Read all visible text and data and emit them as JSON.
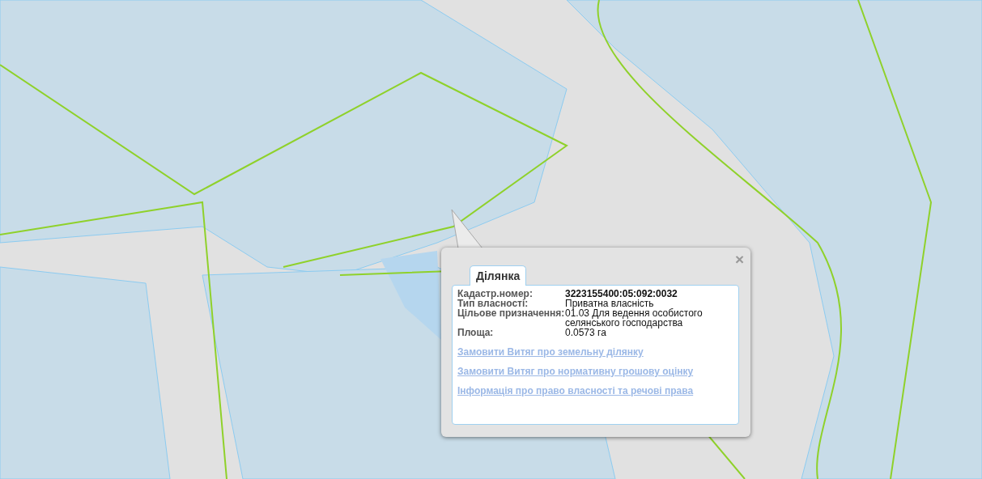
{
  "popup": {
    "close": "×",
    "tabs": [
      {
        "label": "Ділянка",
        "selected": true
      }
    ],
    "rows": [
      {
        "label": "Кадастр.номер:",
        "value": "3223155400:05:092:0032",
        "bold": true
      },
      {
        "label": "Тип власності:",
        "value": "Приватна власність",
        "bold": false
      },
      {
        "label": "Цільове призначення:",
        "value": "01.03 Для ведення особистого селянського господарства",
        "bold": false
      },
      {
        "label": "Площа:",
        "value": "0.0573 га",
        "bold": false
      }
    ],
    "links": [
      "Замовити Витяг про земельну ділянку",
      "Замовити Витяг про нормативну грошову оцінку",
      "Інформація про право власності та речові права"
    ]
  }
}
